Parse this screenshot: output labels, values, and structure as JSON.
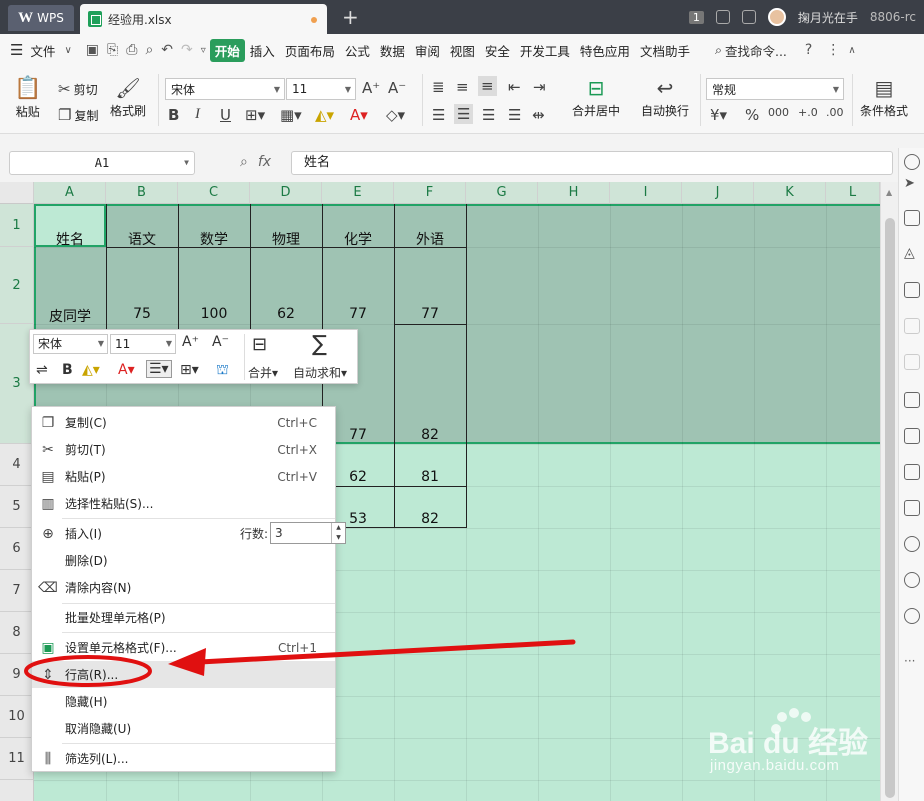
{
  "titlebar": {
    "wps_label": "WPS",
    "file_tab": "经验用.xlsx",
    "new_tab": "+",
    "badge": "1",
    "user": "掬月光在手",
    "account": "8806-rc"
  },
  "menubar": {
    "file": "文件",
    "items": [
      "开始",
      "插入",
      "页面布局",
      "公式",
      "数据",
      "审阅",
      "视图",
      "安全",
      "开发工具",
      "特色应用",
      "文档助手"
    ],
    "search": "查找命令...",
    "help": "?"
  },
  "ribbon": {
    "paste": "粘贴",
    "cut": "剪切",
    "copy": "复制",
    "format_painter": "格式刷",
    "font": "宋体",
    "font_size": "11",
    "merge_center": "合并居中",
    "auto_wrap": "自动换行",
    "number_format": "常规",
    "conditional_format": "条件格式"
  },
  "formulabar": {
    "cell_ref": "A1",
    "fx": "fx",
    "content": "姓名"
  },
  "sheet": {
    "columns": [
      "A",
      "B",
      "C",
      "D",
      "E",
      "F",
      "G",
      "H",
      "I",
      "J",
      "K",
      "L"
    ],
    "rows": [
      "1",
      "2",
      "3",
      "4",
      "5",
      "6",
      "7",
      "8",
      "9",
      "10",
      "11"
    ],
    "header": [
      "姓名",
      "语文",
      "数学",
      "物理",
      "化学",
      "外语"
    ],
    "row2": [
      "皮同学",
      "75",
      "100",
      "62",
      "77",
      "77"
    ],
    "row3_visible": [
      "77",
      "82"
    ],
    "row4_visible": [
      "62",
      "81"
    ],
    "row5_visible": [
      "53",
      "82"
    ]
  },
  "minitoolbar": {
    "font": "宋体",
    "size": "11",
    "merge": "合并",
    "autosum": "自动求和"
  },
  "contextmenu": {
    "items": [
      {
        "label": "复制(C)",
        "key": "Ctrl+C"
      },
      {
        "label": "剪切(T)",
        "key": "Ctrl+X"
      },
      {
        "label": "粘贴(P)",
        "key": "Ctrl+V"
      },
      {
        "label": "选择性粘贴(S)...",
        "key": ""
      },
      {
        "label": "插入(I)",
        "key": ""
      },
      {
        "label": "删除(D)",
        "key": ""
      },
      {
        "label": "清除内容(N)",
        "key": ""
      },
      {
        "label": "批量处理单元格(P)",
        "key": ""
      },
      {
        "label": "设置单元格格式(F)...",
        "key": "Ctrl+1"
      },
      {
        "label": "行高(R)...",
        "key": ""
      },
      {
        "label": "隐藏(H)",
        "key": ""
      },
      {
        "label": "取消隐藏(U)",
        "key": ""
      },
      {
        "label": "筛选列(L)...",
        "key": ""
      }
    ],
    "rows_label": "行数:",
    "rows_value": "3"
  },
  "watermark": {
    "brand": "Bai du 经验",
    "url": "jingyan.baidu.com"
  },
  "colors": {
    "accent": "#21a366",
    "selection": "#9fc3b3",
    "sheet_bg": "#bde9d4",
    "annotation": "#e01010"
  }
}
